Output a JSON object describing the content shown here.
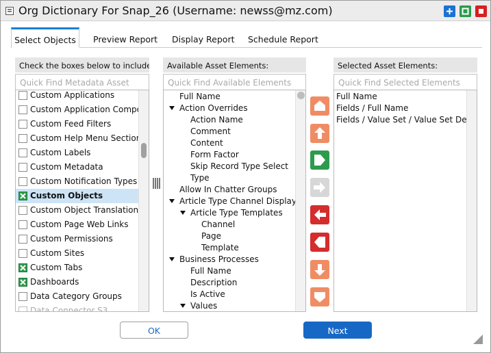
{
  "window": {
    "title": "Org Dictionary For Snap_26 (Username: newss@mz.com)",
    "controls": [
      {
        "name": "add",
        "color": "#1a73d4"
      },
      {
        "name": "restore",
        "color": "#2e9b4c"
      },
      {
        "name": "close",
        "color": "#d72020"
      }
    ]
  },
  "tabs": [
    {
      "label": "Select Objects",
      "active": true
    },
    {
      "label": "Preview Report",
      "active": false
    },
    {
      "label": "Display Report",
      "active": false
    },
    {
      "label": "Schedule Report",
      "active": false
    }
  ],
  "left_panel": {
    "header": "Check the boxes below to include",
    "search_placeholder": "Quick Find Metadata Asset",
    "items": [
      {
        "label": "Custom Applications",
        "checked": false
      },
      {
        "label": "Custom Application Compon",
        "checked": false
      },
      {
        "label": "Custom Feed Filters",
        "checked": false
      },
      {
        "label": "Custom Help Menu Section",
        "checked": false
      },
      {
        "label": "Custom Labels",
        "checked": false
      },
      {
        "label": "Custom Metadata",
        "checked": false
      },
      {
        "label": "Custom Notification Types",
        "checked": false
      },
      {
        "label": "Custom Objects",
        "checked": true,
        "selected": true
      },
      {
        "label": "Custom Object Translations",
        "checked": false
      },
      {
        "label": "Custom Page Web Links",
        "checked": false
      },
      {
        "label": "Custom Permissions",
        "checked": false
      },
      {
        "label": "Custom Sites",
        "checked": false
      },
      {
        "label": "Custom Tabs",
        "checked": true
      },
      {
        "label": "Dashboards",
        "checked": true
      },
      {
        "label": "Data Category Groups",
        "checked": false
      },
      {
        "label": "Data Connector S3",
        "checked": false
      }
    ]
  },
  "middle_panel": {
    "header": "Available Asset Elements:",
    "search_placeholder": "Quick Find Available Elements",
    "items": [
      {
        "label": "Full Name",
        "level": 0,
        "expander": false
      },
      {
        "label": "Action Overrides",
        "level": 0,
        "expander": true
      },
      {
        "label": "Action Name",
        "level": 1,
        "expander": false
      },
      {
        "label": "Comment",
        "level": 1,
        "expander": false
      },
      {
        "label": "Content",
        "level": 1,
        "expander": false
      },
      {
        "label": "Form Factor",
        "level": 1,
        "expander": false
      },
      {
        "label": "Skip Record Type Select",
        "level": 1,
        "expander": false
      },
      {
        "label": "Type",
        "level": 1,
        "expander": false
      },
      {
        "label": "Allow In Chatter Groups",
        "level": 0,
        "expander": false
      },
      {
        "label": "Article Type Channel Display",
        "level": 0,
        "expander": true
      },
      {
        "label": "Article Type Templates",
        "level": 1,
        "expander": true
      },
      {
        "label": "Channel",
        "level": 2,
        "expander": false
      },
      {
        "label": "Page",
        "level": 2,
        "expander": false
      },
      {
        "label": "Template",
        "level": 2,
        "expander": false
      },
      {
        "label": "Business Processes",
        "level": 0,
        "expander": true
      },
      {
        "label": "Full Name",
        "level": 1,
        "expander": false
      },
      {
        "label": "Description",
        "level": 1,
        "expander": false
      },
      {
        "label": "Is Active",
        "level": 1,
        "expander": false
      },
      {
        "label": "Values",
        "level": 1,
        "expander": true
      }
    ]
  },
  "move_buttons": [
    {
      "name": "move-top",
      "color": "#f08c64",
      "enabled": true
    },
    {
      "name": "move-up",
      "color": "#f08c64",
      "enabled": true
    },
    {
      "name": "add-all",
      "color": "#2e9b4c",
      "enabled": true
    },
    {
      "name": "add-selected",
      "color": "#d7d7d7",
      "enabled": false
    },
    {
      "name": "remove-selected",
      "color": "#d42d2d",
      "enabled": true
    },
    {
      "name": "remove-all",
      "color": "#d42d2d",
      "enabled": true
    },
    {
      "name": "move-down",
      "color": "#f08c64",
      "enabled": true
    },
    {
      "name": "move-bottom",
      "color": "#f08c64",
      "enabled": true
    }
  ],
  "right_panel": {
    "header": "Selected Asset Elements:",
    "search_placeholder": "Quick Find Selected Elements",
    "items": [
      "Full Name",
      "Fields / Full Name",
      "Fields / Value Set / Value Set De"
    ]
  },
  "footer": {
    "ok_label": "OK",
    "next_label": "Next"
  }
}
